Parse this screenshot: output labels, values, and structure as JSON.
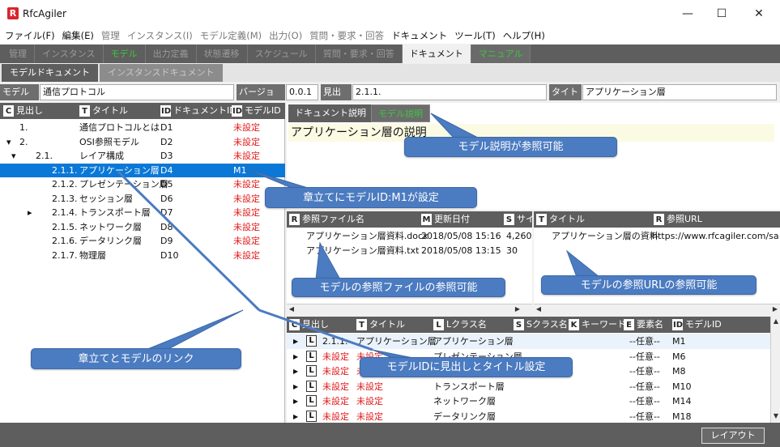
{
  "app": {
    "title": "RfcAgiler",
    "logo": "R"
  },
  "window_buttons": {
    "minimize": "—",
    "maximize": "☐",
    "close": "✕"
  },
  "menu": [
    {
      "label": "ファイル(F)",
      "dim": false
    },
    {
      "label": "編集(E)",
      "dim": false
    },
    {
      "label": "管理",
      "dim": true
    },
    {
      "label": "インスタンス(I)",
      "dim": true
    },
    {
      "label": "モデル定義(M)",
      "dim": true
    },
    {
      "label": "出力(O)",
      "dim": true
    },
    {
      "label": "質問・要求・回答",
      "dim": true
    },
    {
      "label": "ドキュメント",
      "dim": false
    },
    {
      "label": "ツール(T)",
      "dim": false
    },
    {
      "label": "ヘルプ(H)",
      "dim": false
    }
  ],
  "top_tabs": [
    {
      "label": "管理",
      "style": "dim"
    },
    {
      "label": "インスタンス",
      "style": "dim"
    },
    {
      "label": "モデル",
      "style": "green"
    },
    {
      "label": "出力定義",
      "style": "dim"
    },
    {
      "label": "状態遷移",
      "style": "dim"
    },
    {
      "label": "スケジュール",
      "style": "dim"
    },
    {
      "label": "質問・要求・回答",
      "style": "dim"
    },
    {
      "label": "ドキュメント",
      "style": "active"
    },
    {
      "label": "マニュアル",
      "style": "greenbg"
    }
  ],
  "sub_tabs": [
    {
      "label": "モデルドキュメント",
      "dim": false
    },
    {
      "label": "インスタンスドキュメント",
      "dim": true
    }
  ],
  "fields": {
    "model_name_label": "モデル名",
    "model_name_value": "通信プロトコル",
    "version_label": "バージョン",
    "version_value": "0.0.1",
    "heading_label": "見出し",
    "heading_value": "2.1.1.",
    "title_label": "タイトル",
    "title_value": "アプリケーション層"
  },
  "tree": {
    "headers": {
      "heading": "見出し",
      "title": "タイトル",
      "doc_id": "ドキュメントID",
      "model_id": "モデルID"
    },
    "badges": {
      "heading": "C",
      "title": "T",
      "doc_id": "ID",
      "model_id": "ID"
    },
    "rows": [
      {
        "toggle": "",
        "heading": "1.",
        "title": "通信プロトコルとは",
        "doc_id": "D1",
        "model_id": "未設定",
        "selected": false
      },
      {
        "toggle": "▾",
        "heading": "2.",
        "title": "OSI参照モデル",
        "doc_id": "D2",
        "model_id": "未設定",
        "selected": false
      },
      {
        "toggle": "▾",
        "heading": "2.1.",
        "title": "レイア構成",
        "doc_id": "D3",
        "model_id": "未設定",
        "selected": false
      },
      {
        "toggle": "",
        "heading": "2.1.1.",
        "title": "アプリケーション層",
        "doc_id": "D4",
        "model_id": "M1",
        "selected": true
      },
      {
        "toggle": "",
        "heading": "2.1.2.",
        "title": "プレゼンテーション層",
        "doc_id": "D5",
        "model_id": "未設定",
        "selected": false
      },
      {
        "toggle": "",
        "heading": "2.1.3.",
        "title": "セッション層",
        "doc_id": "D6",
        "model_id": "未設定",
        "selected": false
      },
      {
        "toggle": "▸",
        "heading": "2.1.4.",
        "title": "トランスポート層",
        "doc_id": "D7",
        "model_id": "未設定",
        "selected": false
      },
      {
        "toggle": "",
        "heading": "2.1.5.",
        "title": "ネットワーク層",
        "doc_id": "D8",
        "model_id": "未設定",
        "selected": false
      },
      {
        "toggle": "",
        "heading": "2.1.6.",
        "title": "データリンク層",
        "doc_id": "D9",
        "model_id": "未設定",
        "selected": false
      },
      {
        "toggle": "",
        "heading": "2.1.7.",
        "title": "物理層",
        "doc_id": "D10",
        "model_id": "未設定",
        "selected": false
      }
    ]
  },
  "desc_tabs": {
    "doc_desc": "ドキュメント説明",
    "model_desc": "モデル説明"
  },
  "desc_text": "アプリケーション層の説明",
  "ref_files": {
    "headers": {
      "name": "参照ファイル名",
      "updated": "更新日付",
      "size": "サイ"
    },
    "badges": {
      "name": "R",
      "updated": "M",
      "size": "S"
    },
    "rows": [
      {
        "name": "アプリケーション層資料.docx",
        "updated": "2018/05/08 15:16",
        "size": "4,260"
      },
      {
        "name": "アプリケーション層資料.txt",
        "updated": "2018/05/08 13:15",
        "size": "30"
      }
    ]
  },
  "ref_urls": {
    "headers": {
      "title": "タイトル",
      "url": "参照URL"
    },
    "badges": {
      "title": "T",
      "url": "R"
    },
    "rows": [
      {
        "title": "アプリケーション層の資料",
        "url": "https://www.rfcagiler.com/sa"
      }
    ]
  },
  "models": {
    "headers": {
      "heading": "見出し",
      "title": "タイトル",
      "lclass": "Lクラス名",
      "sclass": "Sクラス名",
      "keyword": "キーワード",
      "element": "要素名",
      "model_id": "モデルID"
    },
    "badges": {
      "heading": "C",
      "title": "T",
      "lclass": "L",
      "sclass": "S",
      "keyword": "K",
      "element": "E",
      "model_id": "ID"
    },
    "rows": [
      {
        "heading": "2.1.1.",
        "title": "アプリケーション層",
        "lclass": "アプリケーション層",
        "element": "--任意--",
        "model_id": "M1",
        "red": false
      },
      {
        "heading": "未設定",
        "title": "未設定",
        "lclass": "プレゼンテーション層",
        "element": "--任意--",
        "model_id": "M6",
        "red": true
      },
      {
        "heading": "未設定",
        "title": "未設定",
        "lclass": "セッション層",
        "element": "--任意--",
        "model_id": "M8",
        "red": true
      },
      {
        "heading": "未設定",
        "title": "未設定",
        "lclass": "トランスポート層",
        "element": "--任意--",
        "model_id": "M10",
        "red": true
      },
      {
        "heading": "未設定",
        "title": "未設定",
        "lclass": "ネットワーク層",
        "element": "--任意--",
        "model_id": "M14",
        "red": true
      },
      {
        "heading": "未設定",
        "title": "未設定",
        "lclass": "データリンク層",
        "element": "--任意--",
        "model_id": "M18",
        "red": true
      }
    ]
  },
  "layout_button": "レイアウト",
  "callouts": {
    "model_desc": "モデル説明が参照可能",
    "model_id_set": "章立てにモデルID:M1が設定",
    "ref_files": "モデルの参照ファイルの参照可能",
    "ref_urls": "モデルの参照URLの参照可能",
    "chapter_link": "章立てとモデルのリンク",
    "id_heading": "モデルIDに見出しとタイトル設定"
  },
  "colors": {
    "selected": "#0a78d7",
    "unset": "#e01b1b",
    "callout": "#4b7bc0",
    "tab_dark": "#5e5e5e",
    "green_tab": "#3ec63e"
  }
}
